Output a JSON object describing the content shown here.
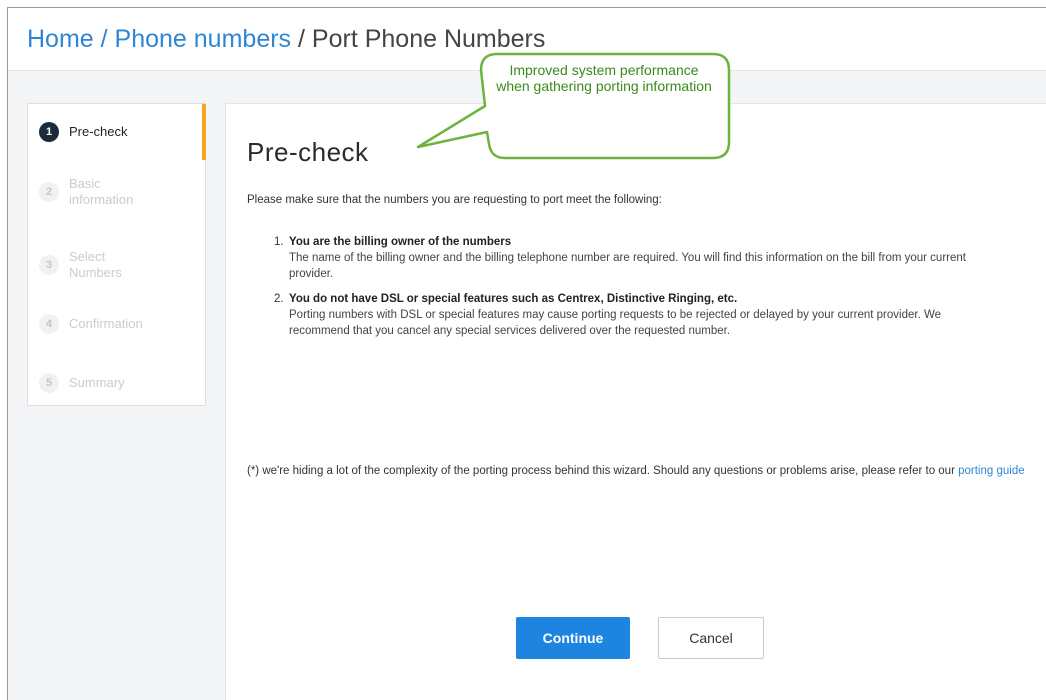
{
  "breadcrumb": {
    "home": "Home",
    "separator": "/",
    "phone_numbers": "Phone numbers",
    "current": "Port Phone Numbers"
  },
  "steps": [
    {
      "number": "1",
      "label": "Pre-check",
      "active": true
    },
    {
      "number": "2",
      "label": "Basic information",
      "active": false
    },
    {
      "number": "3",
      "label": "Select Numbers",
      "active": false
    },
    {
      "number": "4",
      "label": "Confirmation",
      "active": false
    },
    {
      "number": "5",
      "label": "Summary",
      "active": false
    }
  ],
  "main": {
    "title": "Pre-check",
    "intro": "Please make sure that the numbers you are requesting to port meet the following:",
    "requirements": [
      {
        "number": "1.",
        "title": "You are the billing owner of the numbers",
        "body": "The name of the billing owner and the billing telephone number are required. You will find this information on the bill from your current provider."
      },
      {
        "number": "2.",
        "title": "You do not have DSL or special features such as Centrex, Distinctive Ringing, etc.",
        "body": "Porting numbers with DSL or special features may cause porting requests to be rejected or delayed by your current provider. We recommend that you cancel any special services delivered over the requested number."
      }
    ],
    "footnote": "(*) we're hiding a lot of the complexity of the porting process behind this wizard. Should any questions or problems arise, please refer to our",
    "footnote_link": "porting guide",
    "continue_label": "Continue",
    "cancel_label": "Cancel"
  },
  "callout": {
    "text": "Improved system performance when gathering porting information"
  },
  "colors": {
    "accent": "#2f86d4",
    "primary_button": "#1d84e0",
    "active_step_bar": "#f5a623",
    "callout_border": "#6db33f",
    "callout_text": "#3a8a1c"
  }
}
